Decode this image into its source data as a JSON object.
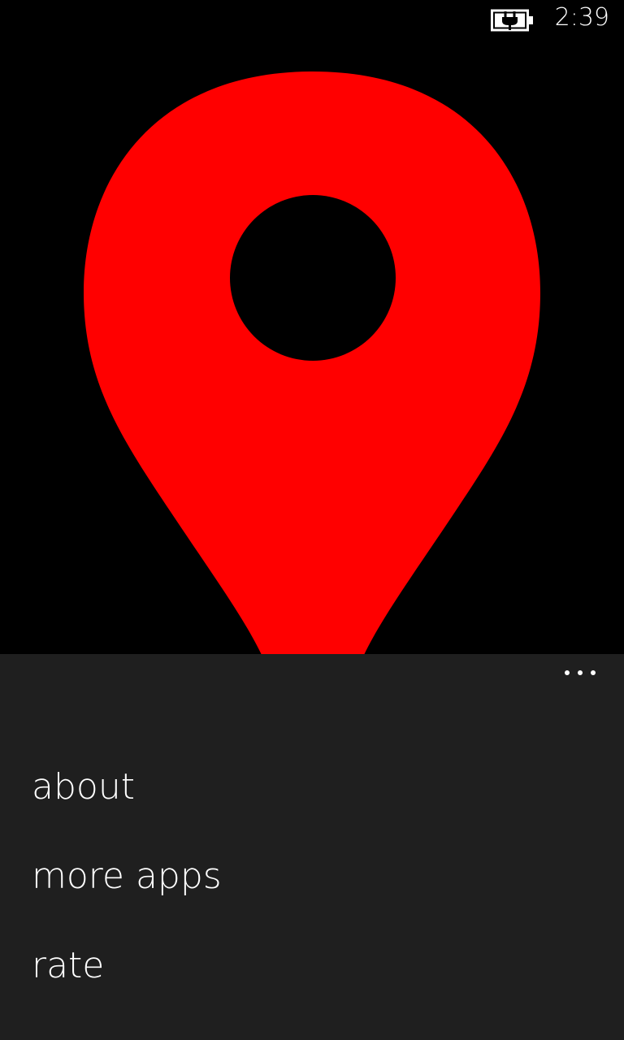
{
  "status_bar": {
    "battery_icon": "battery-charging-icon",
    "time": "2:39"
  },
  "main": {
    "pin_icon": "map-pin-icon",
    "colors": {
      "pin": "#ff0000",
      "background": "#000000"
    }
  },
  "app_bar": {
    "more_icon": "ellipsis-icon",
    "background": "#1f1f1f",
    "menu_items": [
      {
        "label": "about"
      },
      {
        "label": "more apps"
      },
      {
        "label": "rate"
      }
    ]
  }
}
